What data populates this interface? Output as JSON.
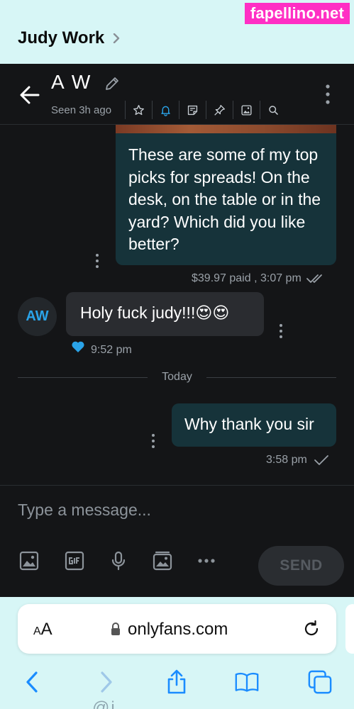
{
  "watermark": "fapellino.net",
  "crumb": {
    "title": "Judy Work"
  },
  "chat": {
    "name": "A W",
    "seen": "Seen 3h ago",
    "toolbar": [
      "star-icon",
      "bell-icon",
      "note-icon",
      "pin-icon",
      "gallery-icon",
      "search-icon"
    ]
  },
  "messages": {
    "out1": {
      "text": "These are some of my top picks for spreads! On the desk, on the table or in the yard? Which did you like better?",
      "meta": "$39.97 paid , 3:07 pm"
    },
    "in1": {
      "avatar": "AW",
      "text": "Holy fuck judy!!!😍😍",
      "meta": "9:52 pm"
    },
    "day_separator": "Today",
    "out2": {
      "text": "Why thank you sir",
      "meta": "3:58 pm"
    }
  },
  "composer": {
    "placeholder": "Type a message...",
    "send_label": "SEND",
    "icons": [
      "image-icon",
      "gif-icon",
      "microphone-icon",
      "vault-icon",
      "more-icon"
    ]
  },
  "browser": {
    "text_size": "AA",
    "url": "onlyfans.com",
    "bottom_peek": "@j"
  },
  "colors": {
    "page_bg": "#d7f6f6",
    "app_bg": "#141517",
    "outgoing_bubble": "#16333a",
    "incoming_bubble": "#2a2c30",
    "accent": "#2aa3e8",
    "watermark_bg": "#ff2fc4"
  }
}
